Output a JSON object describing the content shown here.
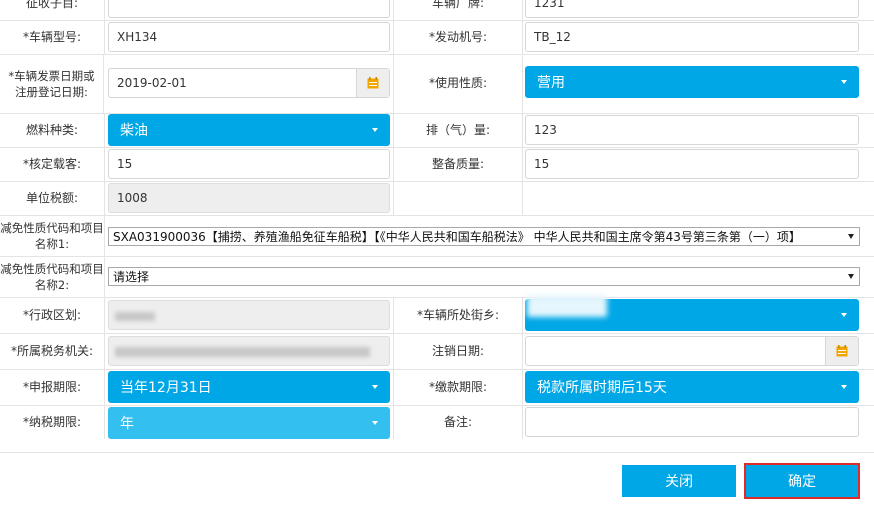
{
  "rows": {
    "r0": {
      "left_label": "征收子目:",
      "left_value": "",
      "right_label": "车辆厂牌:",
      "right_value": "1231"
    },
    "r1": {
      "left_label": "*车辆型号:",
      "left_value": "XH134",
      "right_label": "*发动机号:",
      "right_value": "TB_12"
    },
    "r2": {
      "left_label": "*车辆发票日期或注册登记日期:",
      "left_value": "2019-02-01",
      "right_label": "*使用性质:",
      "right_value": "营用"
    },
    "r3": {
      "left_label": "燃料种类:",
      "left_value": "柴油",
      "right_label": "排（气）量:",
      "right_value": "123"
    },
    "r4": {
      "left_label": "*核定载客:",
      "left_value": "15",
      "right_label": "整备质量:",
      "right_value": "15"
    },
    "r5": {
      "left_label": "单位税额:",
      "left_value": "1008"
    },
    "r6": {
      "left_label": "减免性质代码和项目名称1:",
      "value": "SXA031900036【捕捞、养殖渔船免征车船税】【《中华人民共和国车船税法》 中华人民共和国主席令第43号第三条第（一）项】"
    },
    "r7": {
      "left_label": "减免性质代码和项目名称2:",
      "value": "请选择"
    },
    "r8": {
      "left_label": "*行政区划:",
      "right_label": "*车辆所处街乡:"
    },
    "r9": {
      "left_label": "*所属税务机关:",
      "right_label": "注销日期:",
      "right_value": ""
    },
    "r10": {
      "left_label": "*申报期限:",
      "left_value": "当年12月31日",
      "right_label": "*缴款期限:",
      "right_value": "税款所属时期后15天"
    },
    "r11": {
      "left_label": "*纳税期限:",
      "left_value": "年",
      "right_label": "备注:",
      "right_value": ""
    }
  },
  "buttons": {
    "close": "关闭",
    "confirm": "确定"
  },
  "colors": {
    "accent": "#00a7e6",
    "highlight": "#e02b2b"
  },
  "icons": {
    "calendar": "calendar-icon",
    "caret": "chevron-down-icon"
  }
}
